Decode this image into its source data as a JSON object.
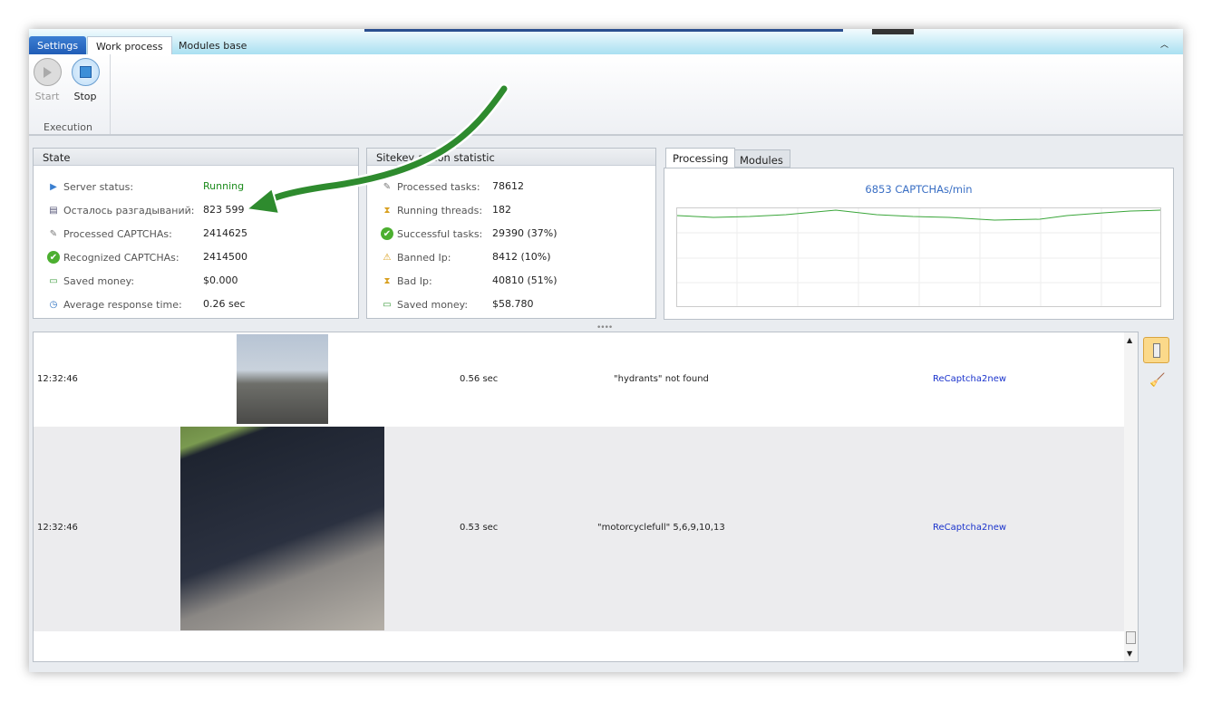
{
  "ribbon": {
    "tabs": [
      "Settings",
      "Work process",
      "Modules base"
    ],
    "start": "Start",
    "stop": "Stop",
    "group": "Execution"
  },
  "state": {
    "title": "State",
    "rows": [
      {
        "label": "Server status:",
        "value": "Running",
        "icon": "play-circle-icon"
      },
      {
        "label": "Осталось разгадываний:",
        "value": "823 599",
        "icon": "document-icon"
      },
      {
        "label": "Processed CAPTCHAs:",
        "value": "2414625",
        "icon": "pencil-document-icon"
      },
      {
        "label": "Recognized CAPTCHAs:",
        "value": "2414500",
        "icon": "check-circle-icon"
      },
      {
        "label": "Saved money:",
        "value": "$0.000",
        "icon": "money-icon"
      },
      {
        "label": "Average response time:",
        "value": "0.26 sec",
        "icon": "clock-icon"
      }
    ]
  },
  "sitekey": {
    "title": "Sitekey addon statistic",
    "rows": [
      {
        "label": "Processed tasks:",
        "value": "78612",
        "icon": "pencil-document-icon"
      },
      {
        "label": "Running threads:",
        "value": "182",
        "icon": "hourglass-icon"
      },
      {
        "label": "Successful tasks:",
        "value": "29390 (37%)",
        "icon": "check-circle-icon"
      },
      {
        "label": "Banned Ip:",
        "value": "8412 (10%)",
        "icon": "warning-icon"
      },
      {
        "label": "Bad Ip:",
        "value": "40810 (51%)",
        "icon": "hourglass-icon"
      },
      {
        "label": "Saved money:",
        "value": "$58.780",
        "icon": "money-icon"
      }
    ]
  },
  "processing": {
    "tabs": [
      "Processing",
      "Modules"
    ],
    "rate": "6853 CAPTCHAs/min"
  },
  "colors": {
    "running": "#1a8a1a",
    "link": "#1a33cc",
    "arrow": "#2e8b2e"
  },
  "log": [
    {
      "time": "12:32:46",
      "duration": "0.56 sec",
      "result": "\"hydrants\" not found",
      "module": "ReCaptcha2new"
    },
    {
      "time": "12:32:46",
      "duration": "0.53 sec",
      "result": "\"motorcyclefull\" 5,6,9,10,13",
      "module": "ReCaptcha2new"
    }
  ]
}
